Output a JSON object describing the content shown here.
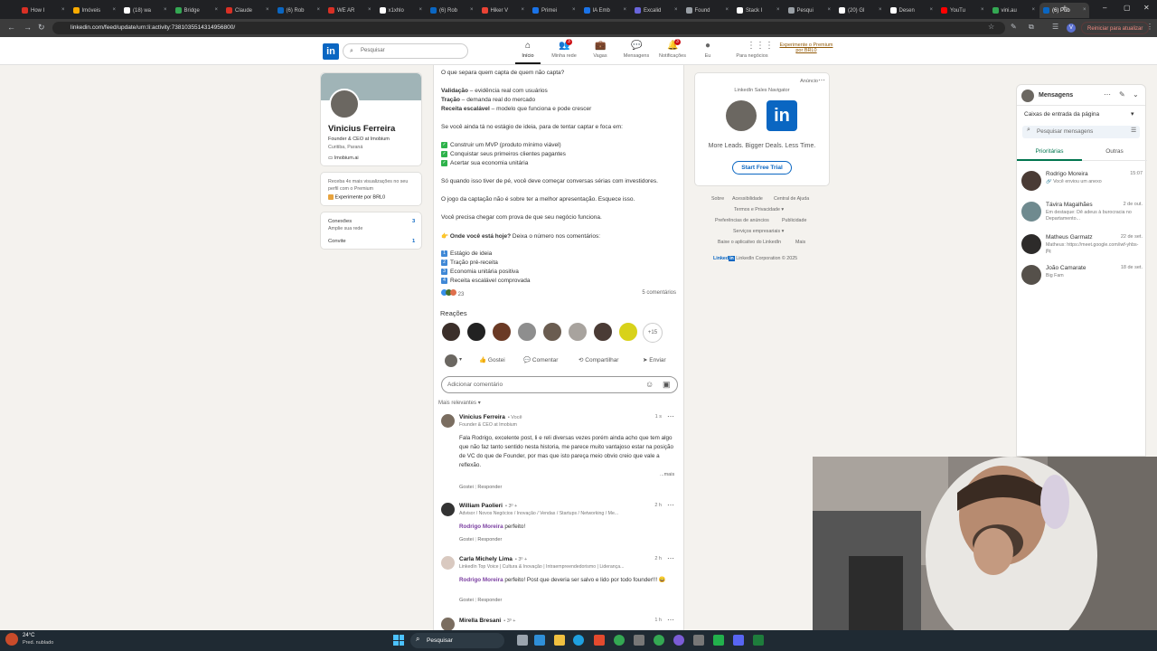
{
  "browser": {
    "tabs": [
      {
        "label": "How I",
        "color": "#d93025"
      },
      {
        "label": "Imóveis",
        "color": "#f9ab00"
      },
      {
        "label": "(18) wa",
        "color": "#ffffff"
      },
      {
        "label": "Bridge",
        "color": "#34a853"
      },
      {
        "label": "Claude",
        "color": "#d93025"
      },
      {
        "label": "(6) Rob",
        "color": "#0a66c2"
      },
      {
        "label": "WE AR",
        "color": "#d93025"
      },
      {
        "label": "x1xhlo",
        "color": "#ffffff"
      },
      {
        "label": "(6) Rob",
        "color": "#0a66c2"
      },
      {
        "label": "Hiker V",
        "color": "#ea4335"
      },
      {
        "label": "Primei",
        "color": "#1a73e8"
      },
      {
        "label": "IA Emb",
        "color": "#1a73e8"
      },
      {
        "label": "Excalid",
        "color": "#6965db"
      },
      {
        "label": "Found",
        "color": "#9aa0a6"
      },
      {
        "label": "Stack I",
        "color": "#ffffff"
      },
      {
        "label": "Pesqui",
        "color": "#9aa0a6"
      },
      {
        "label": "(20) Gl",
        "color": "#ffffff"
      },
      {
        "label": "Desen",
        "color": "#ffffff"
      },
      {
        "label": "YouTu",
        "color": "#ff0000"
      },
      {
        "label": "vini.au",
        "color": "#34a853"
      },
      {
        "label": "(6) Pub",
        "color": "#0a66c2"
      }
    ],
    "url": "linkedin.com/feed/update/urn:li:activity:7381035514314956800/",
    "update_button": "Reiniciar para atualizar"
  },
  "header": {
    "logo": "in",
    "search_placeholder": "Pesquisar",
    "nav": [
      {
        "label": "Início",
        "icon": "home-icon",
        "badge": ""
      },
      {
        "label": "Minha rede",
        "icon": "network-icon",
        "badge": "3"
      },
      {
        "label": "Vagas",
        "icon": "briefcase-icon",
        "badge": ""
      },
      {
        "label": "Mensagens",
        "icon": "chat-icon",
        "badge": ""
      },
      {
        "label": "Notificações",
        "icon": "bell-icon",
        "badge": "3"
      },
      {
        "label": "Eu",
        "icon": "avatar-icon",
        "badge": ""
      },
      {
        "label": "Para negócios",
        "icon": "grid-icon",
        "badge": ""
      }
    ],
    "premium": "Experimente o Premium por BRL0"
  },
  "profile": {
    "name": "Vinicius Ferreira",
    "headline": "Founder & CEO at Imobium",
    "location": "Curitiba, Paraná",
    "company": "Imobium.ai",
    "premium_text": "Receba 4x mais visualizações no seu perfil com o Premium",
    "premium_cta": "Experimente por BRL0",
    "connections_label": "Conexões",
    "connections_sub": "Amplie sua rede",
    "connections_count": "3",
    "invite_label": "Convite",
    "invite_count": "1"
  },
  "post": {
    "lines": [
      "O que separa quem capta de quem não capta?",
      "",
      "",
      "",
      "Se você ainda tá no estágio de ideia, para de tentar captar e foca em:",
      "",
      "",
      "",
      "Só quando isso tiver de pé, você deve começar conversas sérias com investidores.",
      "O jogo da captação não é sobre ter a melhor apresentação. Esquece isso.",
      "Você precisa chegar com prova de que seu negócio funciona."
    ],
    "bullets": [
      {
        "bold": "Validação",
        "rest": " – evidência real com usuários"
      },
      {
        "bold": "Tração",
        "rest": " – demanda real do mercado"
      },
      {
        "bold": "Receita escalável",
        "rest": " – modelo que funciona e pode crescer"
      }
    ],
    "checks": [
      "Construir um MVP (produto mínimo viável)",
      "Conquistar seus primeiros clientes pagantes",
      "Acertar sua economia unitária"
    ],
    "question_bold": "Onde você está hoje?",
    "question_rest": " Deixa o número nos comentários:",
    "options": [
      "Estágio de ideia",
      "Tração pré-receita",
      "Economia unitária positiva",
      "Receita escalável comprovada"
    ],
    "reaction_count": "23",
    "comment_count": "5 comentários",
    "reactions_title": "Reações",
    "more_reactors": "+15",
    "actions": [
      "Gostei",
      "Comentar",
      "Compartilhar",
      "Enviar"
    ],
    "comment_placeholder": "Adicionar comentário",
    "sort_label": "Mais relevantes"
  },
  "comments": [
    {
      "name": "Vinicius Ferreira",
      "badge": "• Você",
      "sub": "Founder & CEO at Imobium",
      "time": "1 s",
      "mention": "",
      "text": "Fala Rodrigo, excelente post, li e reli diversas vezes porém ainda acho que tem algo que não faz tanto sentido nesta historia, me parece muito vantajoso estar na posição de VC do que de Founder, por mas que isto pareça meio obvio creio que vale a reflexão.",
      "more": "...mais",
      "like": "Gostei",
      "reply": "Responder"
    },
    {
      "name": "William Paolieri",
      "badge": "• 3º +",
      "sub": "Advisor / Novos Negócios / Inovação / Vendas / Startups / Networking / Me...",
      "time": "2 h",
      "mention": "Rodrigo Moreira",
      "text": " perfeito!",
      "more": "",
      "like": "Gostei",
      "reply": "Responder"
    },
    {
      "name": "Carla Michely Lima",
      "badge": "• 3º +",
      "sub": "LinkedIn Top Voice | Cultura & Inovação | Intraempreendedorismo | Liderança...",
      "time": "2 h",
      "mention": "Rodrigo Moreira",
      "text": " perfeito! Post que deveria ser salvo e lido por todo founder!!! 😄",
      "more": "",
      "like": "Gostei",
      "reply": "Responder"
    },
    {
      "name": "Mirella Bresani",
      "badge": "• 3º +",
      "sub": "",
      "time": "1 h",
      "mention": "",
      "text": "",
      "more": "",
      "like": "",
      "reply": ""
    }
  ],
  "ad": {
    "label": "Anúncio",
    "title": "LinkedIn Sales Navigator",
    "tagline": "More Leads. Bigger Deals. Less Time.",
    "cta": "Start Free Trial"
  },
  "footer": {
    "links": [
      "Sobre",
      "Acessibilidade",
      "Central de Ajuda",
      "Termos e Privacidade ▾",
      "Preferências de anúncios",
      "Publicidade",
      "Serviços empresariais ▾",
      "Baixe o aplicativo do LinkedIn",
      "Mais"
    ],
    "copyright": "LinkedIn Corporation © 2025"
  },
  "messaging": {
    "title": "Mensagens",
    "inbox": "Caixas de entrada da página",
    "search_placeholder": "Pesquisar mensagens",
    "tabs": [
      "Prioritárias",
      "Outras"
    ],
    "conversations": [
      {
        "name": "Rodrigo Moreira",
        "date": "15:07",
        "preview": "🔗 Você enviou um anexo"
      },
      {
        "name": "Távira Magalhães",
        "date": "2 de out.",
        "preview": "Em destaque: Dê adeus à burocracia no Departamento..."
      },
      {
        "name": "Matheus Garmatz",
        "date": "22 de set.",
        "preview": "Matheus: https://meet.google.com/iwf-yhbs-jfq"
      },
      {
        "name": "João Camarate",
        "date": "18 de set.",
        "preview": "Big Fam"
      }
    ]
  },
  "taskbar": {
    "weather_temp": "24°C",
    "weather_desc": "Pred. nublado",
    "search": "Pesquisar"
  },
  "colors": {
    "linkedin_blue": "#0a66c2",
    "premium_gold": "#915907",
    "mention_purple": "#7b3fa1"
  }
}
